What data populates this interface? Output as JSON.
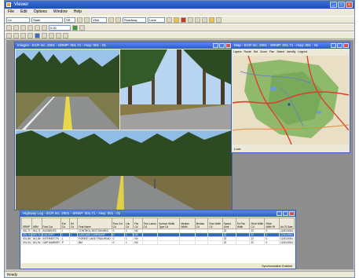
{
  "app": {
    "title": "Viewer"
  },
  "menu": [
    "File",
    "Edit",
    "Options",
    "Window",
    "Help"
  ],
  "toolbar": {
    "box1": "Lic",
    "box2": "State",
    "box3": "SR",
    "box4": "VNA",
    "box5": "Roadway",
    "box6": "Lane",
    "box7": "0.00"
  },
  "image_window": {
    "title": "Images - ECR Inc. 2001 - SRMP: 001.71 - Hwy: 001 - 01"
  },
  "map_window": {
    "title": "Map - ECR Inc. 2001 - SRMP: 001.71 - Hwy: 001 - 01",
    "tabs": [
      "Layers",
      "Route",
      "Set",
      "Zoom",
      "Pan",
      "Select",
      "Identify",
      "Legend"
    ],
    "status": "Lock"
  },
  "table_window": {
    "title": "Highway Log - ECR Inc. 2001 - SRMP: 001.71 - Hwy: 001 - 01",
    "status": "Synchronization Enabled"
  },
  "status_bar": "Ready",
  "table": {
    "headers": [
      "SRMP",
      "ARM",
      "Feat Cat",
      "Ent Cd",
      "Srf Cd",
      "Feat Name",
      "Row Cnt Cd",
      "Lnk Cd",
      "Par Cd",
      "Thru Lanes Cd",
      "Surface Width Type Cd",
      "Median Width",
      "Median Cd",
      "Row Wdth Cd",
      "Speed Limit",
      "Ex Pav Wdth",
      "Shldr Wdth Cd",
      "Shldr Wdth Rt",
      "As Of Date"
    ],
    "rows": [
      [
        "001.71",
        "001.71",
        "INCIDENTS",
        "I",
        "",
        "CONTROL SECTION BEG",
        "0",
        "1",
        "NV",
        "",
        "",
        "",
        "",
        "",
        "22",
        "",
        "22",
        "0",
        "12/31/2004"
      ],
      [
        "001.74",
        "001.74",
        "CULVERT",
        "I",
        "1",
        "CASCADE CORRIDOR",
        "0",
        "1",
        "NV",
        "",
        "",
        "",
        "",
        "",
        "22",
        "",
        "22",
        "0",
        "12/31/2004"
      ],
      [
        "001.85",
        "001.85",
        "INTERSECTN",
        "L",
        "",
        "FOREST LAKE TRAILHEAD",
        "0",
        "1",
        "NV",
        "",
        "",
        "",
        "",
        "",
        "22",
        "",
        "22",
        "0",
        "12/31/2004"
      ],
      [
        "001.94",
        "001.94",
        "GAP MARKER",
        "P",
        "",
        "BM",
        "0",
        "1",
        "NV",
        "",
        "",
        "",
        "",
        "",
        "22",
        "",
        "22",
        "0",
        "12/31/2004"
      ]
    ]
  }
}
